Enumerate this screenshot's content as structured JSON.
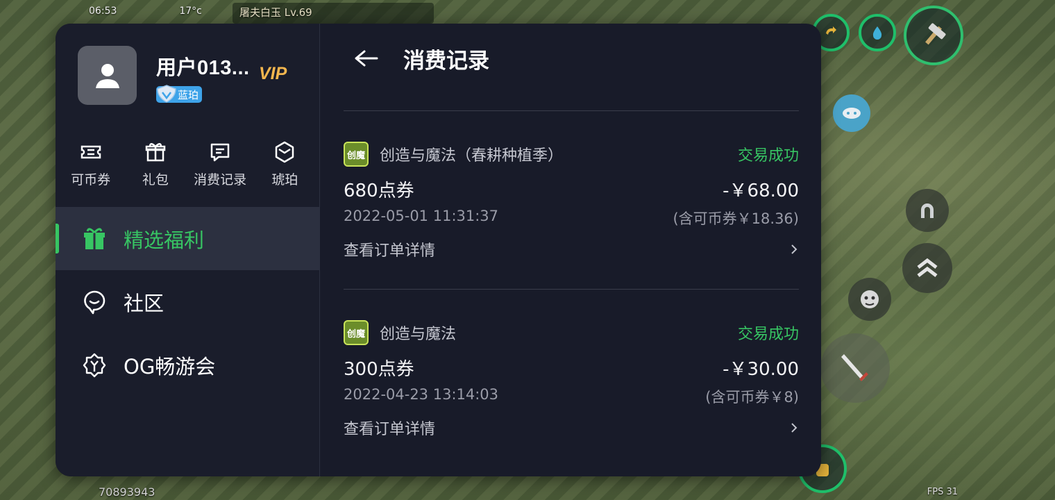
{
  "game_hud": {
    "time": "06:53",
    "temperature": "17°c",
    "target_name": "屠夫白玉 Lv.69",
    "player_id": "70893943",
    "fps": "FPS 31"
  },
  "user": {
    "name": "用户013...",
    "vip_label": "VIP",
    "level_label": "蓝珀"
  },
  "quick_actions": [
    {
      "label": "可币券",
      "icon": "ticket-icon"
    },
    {
      "label": "礼包",
      "icon": "gift-icon"
    },
    {
      "label": "消费记录",
      "icon": "message-list-icon"
    },
    {
      "label": "琥珀",
      "icon": "hexagon-icon"
    }
  ],
  "nav": [
    {
      "label": "精选福利",
      "icon": "gift-icon",
      "active": true
    },
    {
      "label": "社区",
      "icon": "chat-bubble-icon",
      "active": false
    },
    {
      "label": "OG畅游会",
      "icon": "og-badge-icon",
      "active": false
    }
  ],
  "page": {
    "title": "消费记录",
    "back_icon": "arrow-left-icon"
  },
  "records": [
    {
      "game_name": "创造与魔法（春耕种植季）",
      "game_icon_text": "创魔",
      "status": "交易成功",
      "product": "680点券",
      "time": "2022-05-01 11:31:37",
      "amount": "-￥68.00",
      "sub_amount": "(含可币券￥18.36)",
      "detail_label": "查看订单详情"
    },
    {
      "game_name": "创造与魔法",
      "game_icon_text": "创魔",
      "status": "交易成功",
      "product": "300点券",
      "time": "2022-04-23 13:14:03",
      "amount": "-￥30.00",
      "sub_amount": "(含可币券￥8)",
      "detail_label": "查看订单详情"
    }
  ],
  "colors": {
    "panel_bg": "#181b29",
    "accent_green": "#37c563",
    "vip_gold": "#f3b64e",
    "badge_blue": "#3ea3e9"
  }
}
